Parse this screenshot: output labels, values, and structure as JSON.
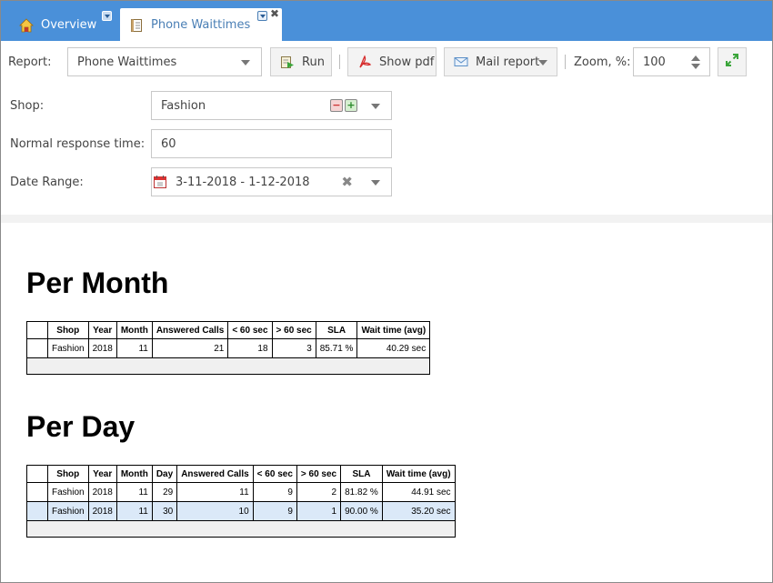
{
  "tabs": [
    {
      "label": "Overview",
      "icon": "home-icon",
      "active": false
    },
    {
      "label": "Phone Waittimes",
      "icon": "report-icon",
      "active": true
    }
  ],
  "toolbar": {
    "report_label": "Report:",
    "report_value": "Phone Waittimes",
    "run_label": "Run",
    "pdf_label": "Show pdf",
    "mail_label": "Mail report",
    "zoom_label": "Zoom, %:",
    "zoom_value": "100"
  },
  "form": {
    "shop_label": "Shop:",
    "shop_value": "Fashion",
    "response_label": "Normal response time:",
    "response_value": "60",
    "date_label": "Date Range:",
    "date_value": "3-11-2018 - 1-12-2018"
  },
  "per_month": {
    "title": "Per Month",
    "headers": [
      "",
      "Shop",
      "Year",
      "Month",
      "Answered Calls",
      "< 60 sec",
      "> 60 sec",
      "SLA",
      "Wait time (avg)"
    ],
    "rows": [
      [
        "",
        "Fashion",
        "2018",
        "11",
        "21",
        "18",
        "3",
        "85.71 %",
        "40.29 sec"
      ]
    ]
  },
  "per_day": {
    "title": "Per Day",
    "headers": [
      "",
      "Shop",
      "Year",
      "Month",
      "Day",
      "Answered Calls",
      "< 60 sec",
      "> 60 sec",
      "SLA",
      "Wait time (avg)"
    ],
    "rows": [
      [
        "",
        "Fashion",
        "2018",
        "11",
        "29",
        "11",
        "9",
        "2",
        "81.82 %",
        "44.91 sec"
      ],
      [
        "",
        "Fashion",
        "2018",
        "11",
        "30",
        "10",
        "9",
        "1",
        "90.00 %",
        "35.20 sec"
      ]
    ]
  },
  "colors": {
    "tabbar": "#4a90d9",
    "highlight_row": "#dbe9f8"
  }
}
